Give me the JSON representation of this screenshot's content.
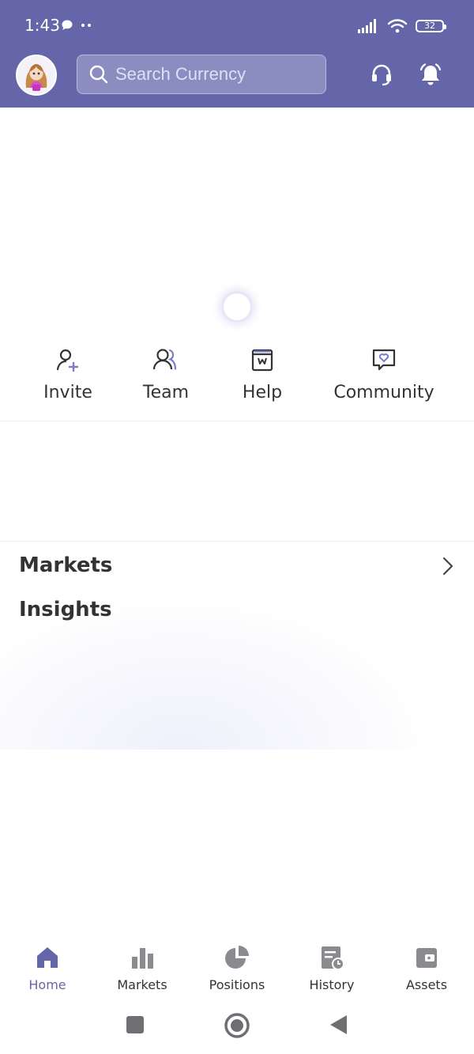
{
  "status_bar": {
    "time": "1:43",
    "battery": "32"
  },
  "header": {
    "search_placeholder": "Search Currency",
    "icons": [
      "avatar",
      "search-icon",
      "headset-icon",
      "bell-icon"
    ]
  },
  "quick_actions": [
    {
      "label": "Invite",
      "icon": "add-user-icon"
    },
    {
      "label": "Team",
      "icon": "team-icon"
    },
    {
      "label": "Help",
      "icon": "help-book-icon"
    },
    {
      "label": "Community",
      "icon": "community-chat-icon"
    }
  ],
  "sections": {
    "markets_title": "Markets",
    "insights_title": "Insights"
  },
  "bottom_nav": {
    "items": [
      {
        "label": "Home",
        "icon": "home-icon",
        "active": true
      },
      {
        "label": "Markets",
        "icon": "markets-bar-icon",
        "active": false
      },
      {
        "label": "Positions",
        "icon": "positions-pie-icon",
        "active": false
      },
      {
        "label": "History",
        "icon": "history-icon",
        "active": false
      },
      {
        "label": "Assets",
        "icon": "wallet-icon",
        "active": false
      }
    ]
  },
  "colors": {
    "brand": "#6566a9",
    "accent_icon": "#7b7ec9",
    "text": "#333333",
    "inactive_icon": "#8a8a8f"
  }
}
